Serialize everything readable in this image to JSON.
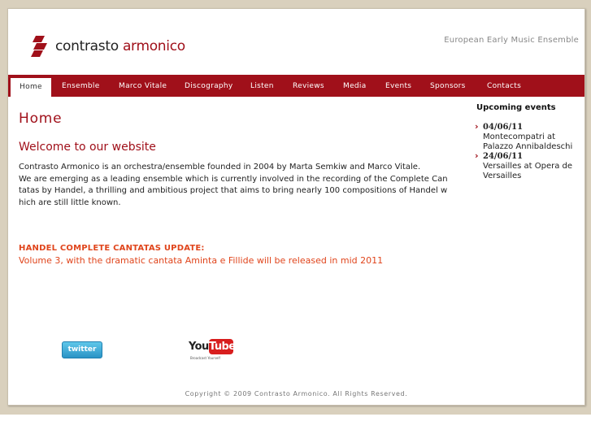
{
  "brand": {
    "name_part1": "contrasto",
    "name_part2": "armonico",
    "tagline": "European Early Music Ensemble",
    "accent_color": "#a0101a"
  },
  "nav": {
    "items": [
      {
        "label": "Home",
        "active": true
      },
      {
        "label": "Ensemble"
      },
      {
        "label": "Marco Vitale"
      },
      {
        "label": "Discography"
      },
      {
        "label": "Listen"
      },
      {
        "label": "Reviews"
      },
      {
        "label": "Media"
      },
      {
        "label": "Events"
      },
      {
        "label": "Sponsors"
      },
      {
        "label": "Contacts"
      }
    ]
  },
  "main": {
    "page_title": "Home",
    "welcome_heading": "Welcome to our website",
    "intro_line1": "Contrasto Armonico is an orchestra/ensemble founded in 2004 by Marta Semkiw and Marco Vitale.",
    "intro_line2": "We are emerging as a leading ensemble which is currently involved in the recording of the Complete Cantatas by Handel, a thrilling and ambitious project that aims to bring nearly 100 compositions of Handel which are still little known.",
    "update_title": "HANDEL COMPLETE CANTATAS UPDATE:",
    "update_text": "Volume 3, with the dramatic cantata Aminta e Fillide will be released in mid 2011",
    "update_color": "#e0451c"
  },
  "sidebar": {
    "heading": "Upcoming events",
    "events": [
      {
        "date": "04/06/11",
        "place": "Montecompatri at Palazzo Annibaldeschi"
      },
      {
        "date": "24/06/11",
        "place": "Versailles at Opera de Versailles"
      }
    ]
  },
  "social": {
    "twitter_label": "twitter",
    "youtube_you": "You",
    "youtube_tube": "Tube",
    "youtube_slogan": "Broadcast Yourself"
  },
  "footer": {
    "copyright": "Copyright © 2009 Contrasto Armonico. All Rights Reserved."
  }
}
